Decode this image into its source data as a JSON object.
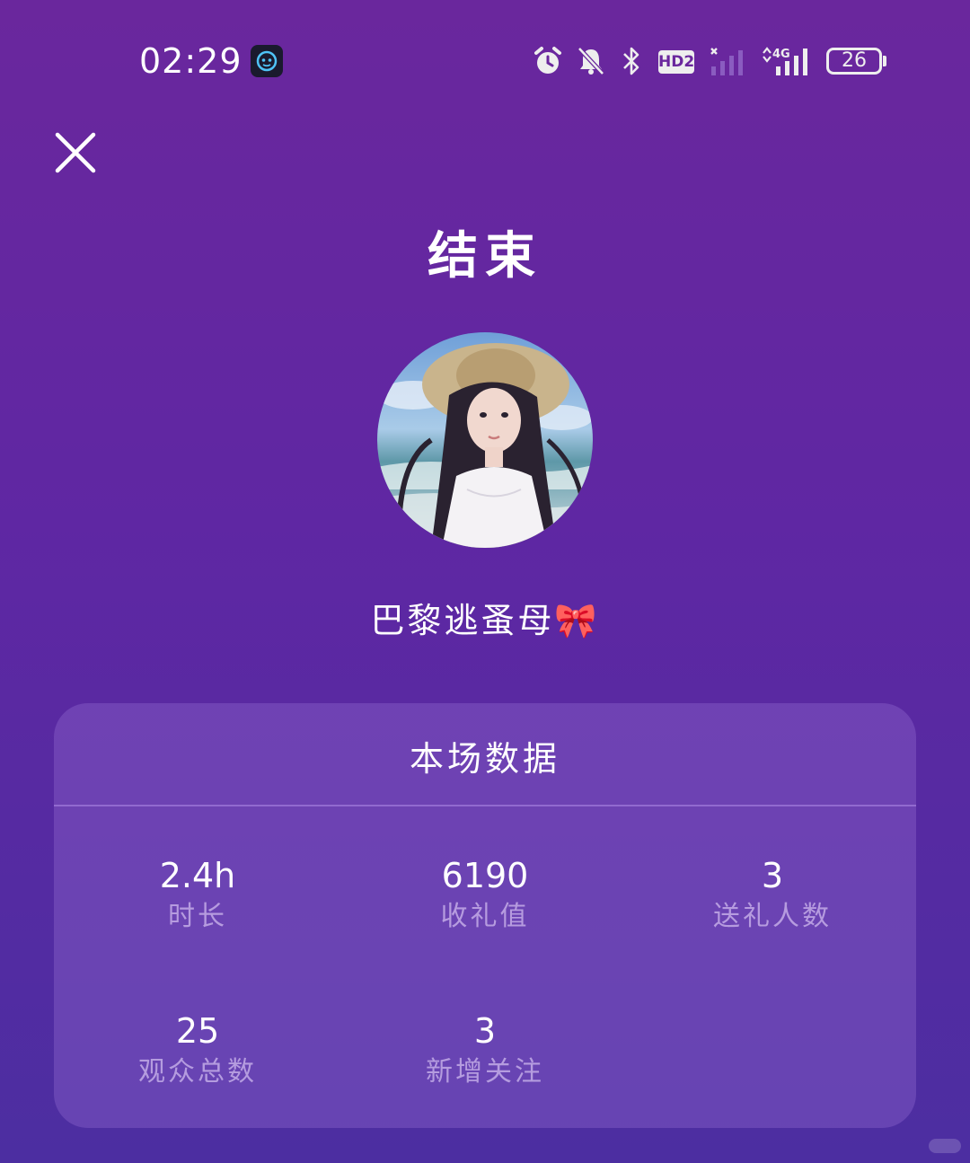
{
  "status_bar": {
    "time": "02:29",
    "app_icon": "robot-app-icon",
    "icons": [
      "alarm-icon",
      "mute-icon",
      "bluetooth-icon",
      "hd-badge",
      "signal-icon",
      "signal-4g-icon",
      "battery-icon"
    ],
    "hd_label": "HD2",
    "network_label": "4G",
    "battery_level": "26"
  },
  "header": {
    "close_icon": "close-icon",
    "title": "结束"
  },
  "profile": {
    "username": "巴黎逃蚤母🎀"
  },
  "stats": {
    "title": "本场数据",
    "items": [
      {
        "value": "2.4h",
        "label": "时长"
      },
      {
        "value": "6190",
        "label": "收礼值"
      },
      {
        "value": "3",
        "label": "送礼人数"
      },
      {
        "value": "25",
        "label": "观众总数"
      },
      {
        "value": "3",
        "label": "新增关注"
      }
    ]
  },
  "colors": {
    "background_top": "#6a279d",
    "background_bottom": "#4c2ea1",
    "text_primary": "#ffffff",
    "label_muted": "#c8b4ee"
  }
}
